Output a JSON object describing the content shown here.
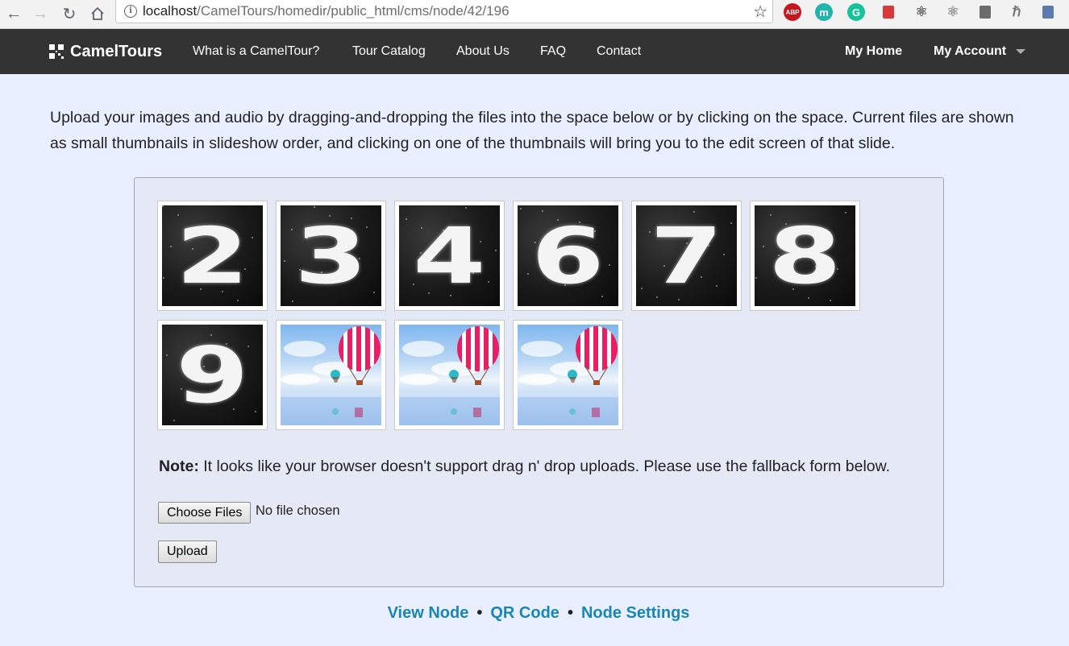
{
  "browser": {
    "url_host": "localhost",
    "url_path": "/CamelTours/homedir/public_html/cms/node/42/196",
    "extensions": [
      {
        "name": "adblock-icon",
        "label": "ABP",
        "color": "#c4161c"
      },
      {
        "name": "mercury-icon",
        "label": "m",
        "color": "#1fb5ad"
      },
      {
        "name": "grammarly-icon",
        "label": "G",
        "color": "#15c39a"
      },
      {
        "name": "bookmark-ext-icon",
        "label": "",
        "color": "#d9373a"
      },
      {
        "name": "react-devtools-icon",
        "label": "⚛",
        "color": "#6b6b6b"
      },
      {
        "name": "react-devtools-alt-icon",
        "label": "⚛",
        "color": "#9a9a9a"
      },
      {
        "name": "balloon-ext-icon",
        "label": "",
        "color": "#6b6b6b"
      },
      {
        "name": "h-ext-icon",
        "label": "ℏ",
        "color": "#777777"
      },
      {
        "name": "calendar-ext-icon",
        "label": "",
        "color": "#5a7ab0"
      }
    ]
  },
  "navbar": {
    "brand": "CamelTours",
    "links": [
      "What is a CamelTour?",
      "Tour Catalog",
      "About Us",
      "FAQ",
      "Contact"
    ],
    "my_home": "My Home",
    "my_account": "My Account"
  },
  "intro": "Upload your images and audio by dragging-and-dropping the files into the space below or by clicking on the space. Current files are shown as small thumbnails in slideshow order, and clicking on one of the thumbnails will bring you to the edit screen of that slide.",
  "thumbnails": [
    {
      "kind": "digit",
      "digit": "2"
    },
    {
      "kind": "digit",
      "digit": "3"
    },
    {
      "kind": "digit",
      "digit": "4"
    },
    {
      "kind": "digit",
      "digit": "6"
    },
    {
      "kind": "digit",
      "digit": "7"
    },
    {
      "kind": "digit",
      "digit": "8"
    },
    {
      "kind": "digit",
      "digit": "9"
    },
    {
      "kind": "balloons"
    },
    {
      "kind": "balloons"
    },
    {
      "kind": "balloons"
    }
  ],
  "note": {
    "label": "Note:",
    "text": " It looks like your browser doesn't support drag n' drop uploads. Please use the fallback form below."
  },
  "form": {
    "choose_files": "Choose Files",
    "no_file": "No file chosen",
    "upload": "Upload"
  },
  "footer": {
    "view_node": "View Node",
    "qr_code": "QR Code",
    "node_settings": "Node Settings",
    "separator": "•"
  }
}
